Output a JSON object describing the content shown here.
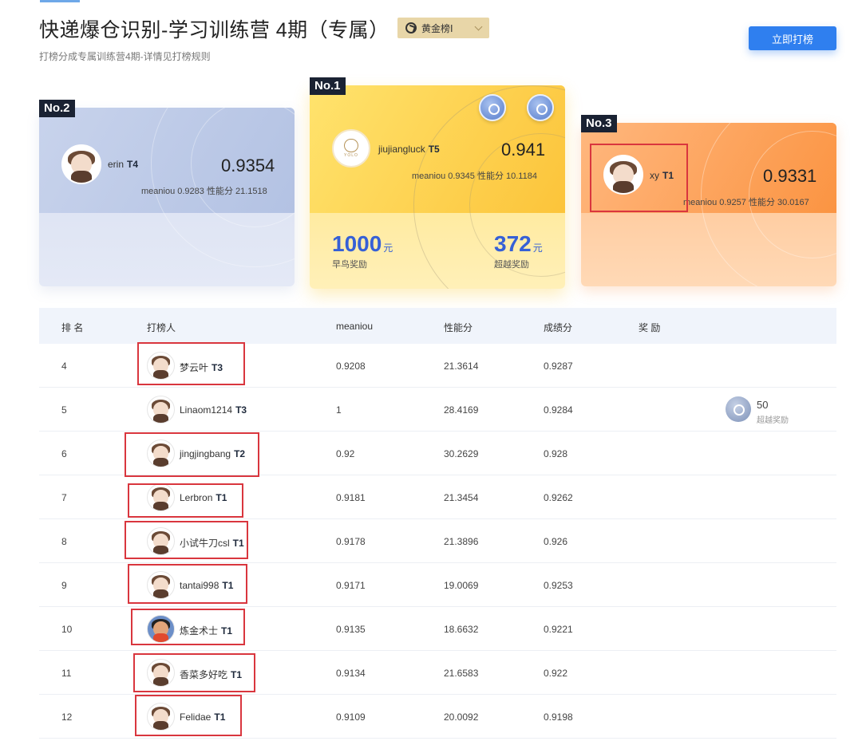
{
  "header": {
    "title": "快递爆仓识别-学习训练营 4期（专属）",
    "subtitle": "打榜分成专属训练营4期-详情见打榜规则",
    "leaderboard_select": "黄金榜Ⅰ",
    "cta_label": "立即打榜"
  },
  "podium": {
    "first": {
      "badge": "No.1",
      "name": "jiujiangluck",
      "tier": "T5",
      "score": "0.941",
      "meta": "meaniou 0.9345   性能分 10.1184",
      "logo_text": "YOLO",
      "rewards": [
        {
          "value": "1000",
          "unit": "元",
          "label": "早鸟奖励"
        },
        {
          "value": "372",
          "unit": "元",
          "label": "超越奖励"
        }
      ]
    },
    "second": {
      "badge": "No.2",
      "name": "erin",
      "tier": "T4",
      "score": "0.9354",
      "meta": "meaniou 0.9283   性能分 21.1518"
    },
    "third": {
      "badge": "No.3",
      "name": "xy",
      "tier": "T1",
      "score": "0.9331",
      "meta": "meaniou 0.9257   性能分 30.0167"
    }
  },
  "table": {
    "headers": {
      "rank": "排 名",
      "user": "打榜人",
      "meaniou": "meaniou",
      "perf": "性能分",
      "result": "成绩分",
      "award": "奖 励"
    },
    "rows": [
      {
        "rank": "4",
        "name": "梦云叶",
        "tier": "T3",
        "meaniou": "0.9208",
        "perf": "21.3614",
        "result": "0.9287"
      },
      {
        "rank": "5",
        "name": "Linaom1214",
        "tier": "T3",
        "meaniou": "1",
        "perf": "28.4169",
        "result": "0.9284",
        "award_value": "50",
        "award_label": "超越奖励"
      },
      {
        "rank": "6",
        "name": "jingjingbang",
        "tier": "T2",
        "meaniou": "0.92",
        "perf": "30.2629",
        "result": "0.928"
      },
      {
        "rank": "7",
        "name": "Lerbron",
        "tier": "T1",
        "meaniou": "0.9181",
        "perf": "21.3454",
        "result": "0.9262"
      },
      {
        "rank": "8",
        "name": "小试牛刀csl",
        "tier": "T1",
        "meaniou": "0.9178",
        "perf": "21.3896",
        "result": "0.926"
      },
      {
        "rank": "9",
        "name": "tantai998",
        "tier": "T1",
        "meaniou": "0.9171",
        "perf": "19.0069",
        "result": "0.9253"
      },
      {
        "rank": "10",
        "name": "炼金术士",
        "tier": "T1",
        "meaniou": "0.9135",
        "perf": "18.6632",
        "result": "0.9221"
      },
      {
        "rank": "11",
        "name": "香菜多好吃",
        "tier": "T1",
        "meaniou": "0.9134",
        "perf": "21.6583",
        "result": "0.922"
      },
      {
        "rank": "12",
        "name": "Felidae",
        "tier": "T1",
        "meaniou": "0.9109",
        "perf": "20.0092",
        "result": "0.9198"
      }
    ]
  }
}
